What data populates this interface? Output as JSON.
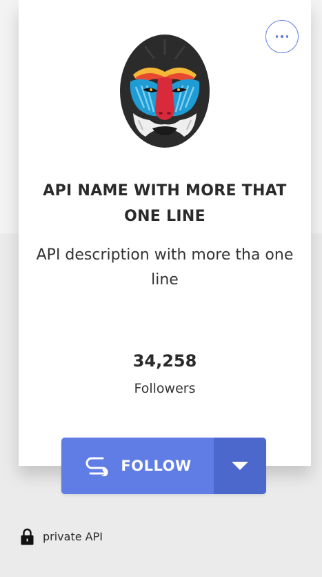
{
  "card": {
    "more_button": {
      "icon": "ellipsis-icon"
    },
    "logo": {
      "icon": "mandrill-logo"
    },
    "api_name": "API NAME WITH MORE THAT ONE LINE",
    "api_description": "API description with more tha one line",
    "followers": {
      "count": "34,258",
      "label": "Followers"
    },
    "follow_button": {
      "label": "FOLLOW",
      "icon": "follow-arrow-icon"
    },
    "dropdown_button": {
      "icon": "caret-down-icon"
    }
  },
  "footer": {
    "private_label": "private API",
    "icon": "lock-icon"
  },
  "colors": {
    "accent": "#5f7de4",
    "accent_dark": "#4d68cc",
    "card_background": "#ffffff",
    "page_background": "#ebebeb",
    "text_primary": "#2a2a2a"
  }
}
